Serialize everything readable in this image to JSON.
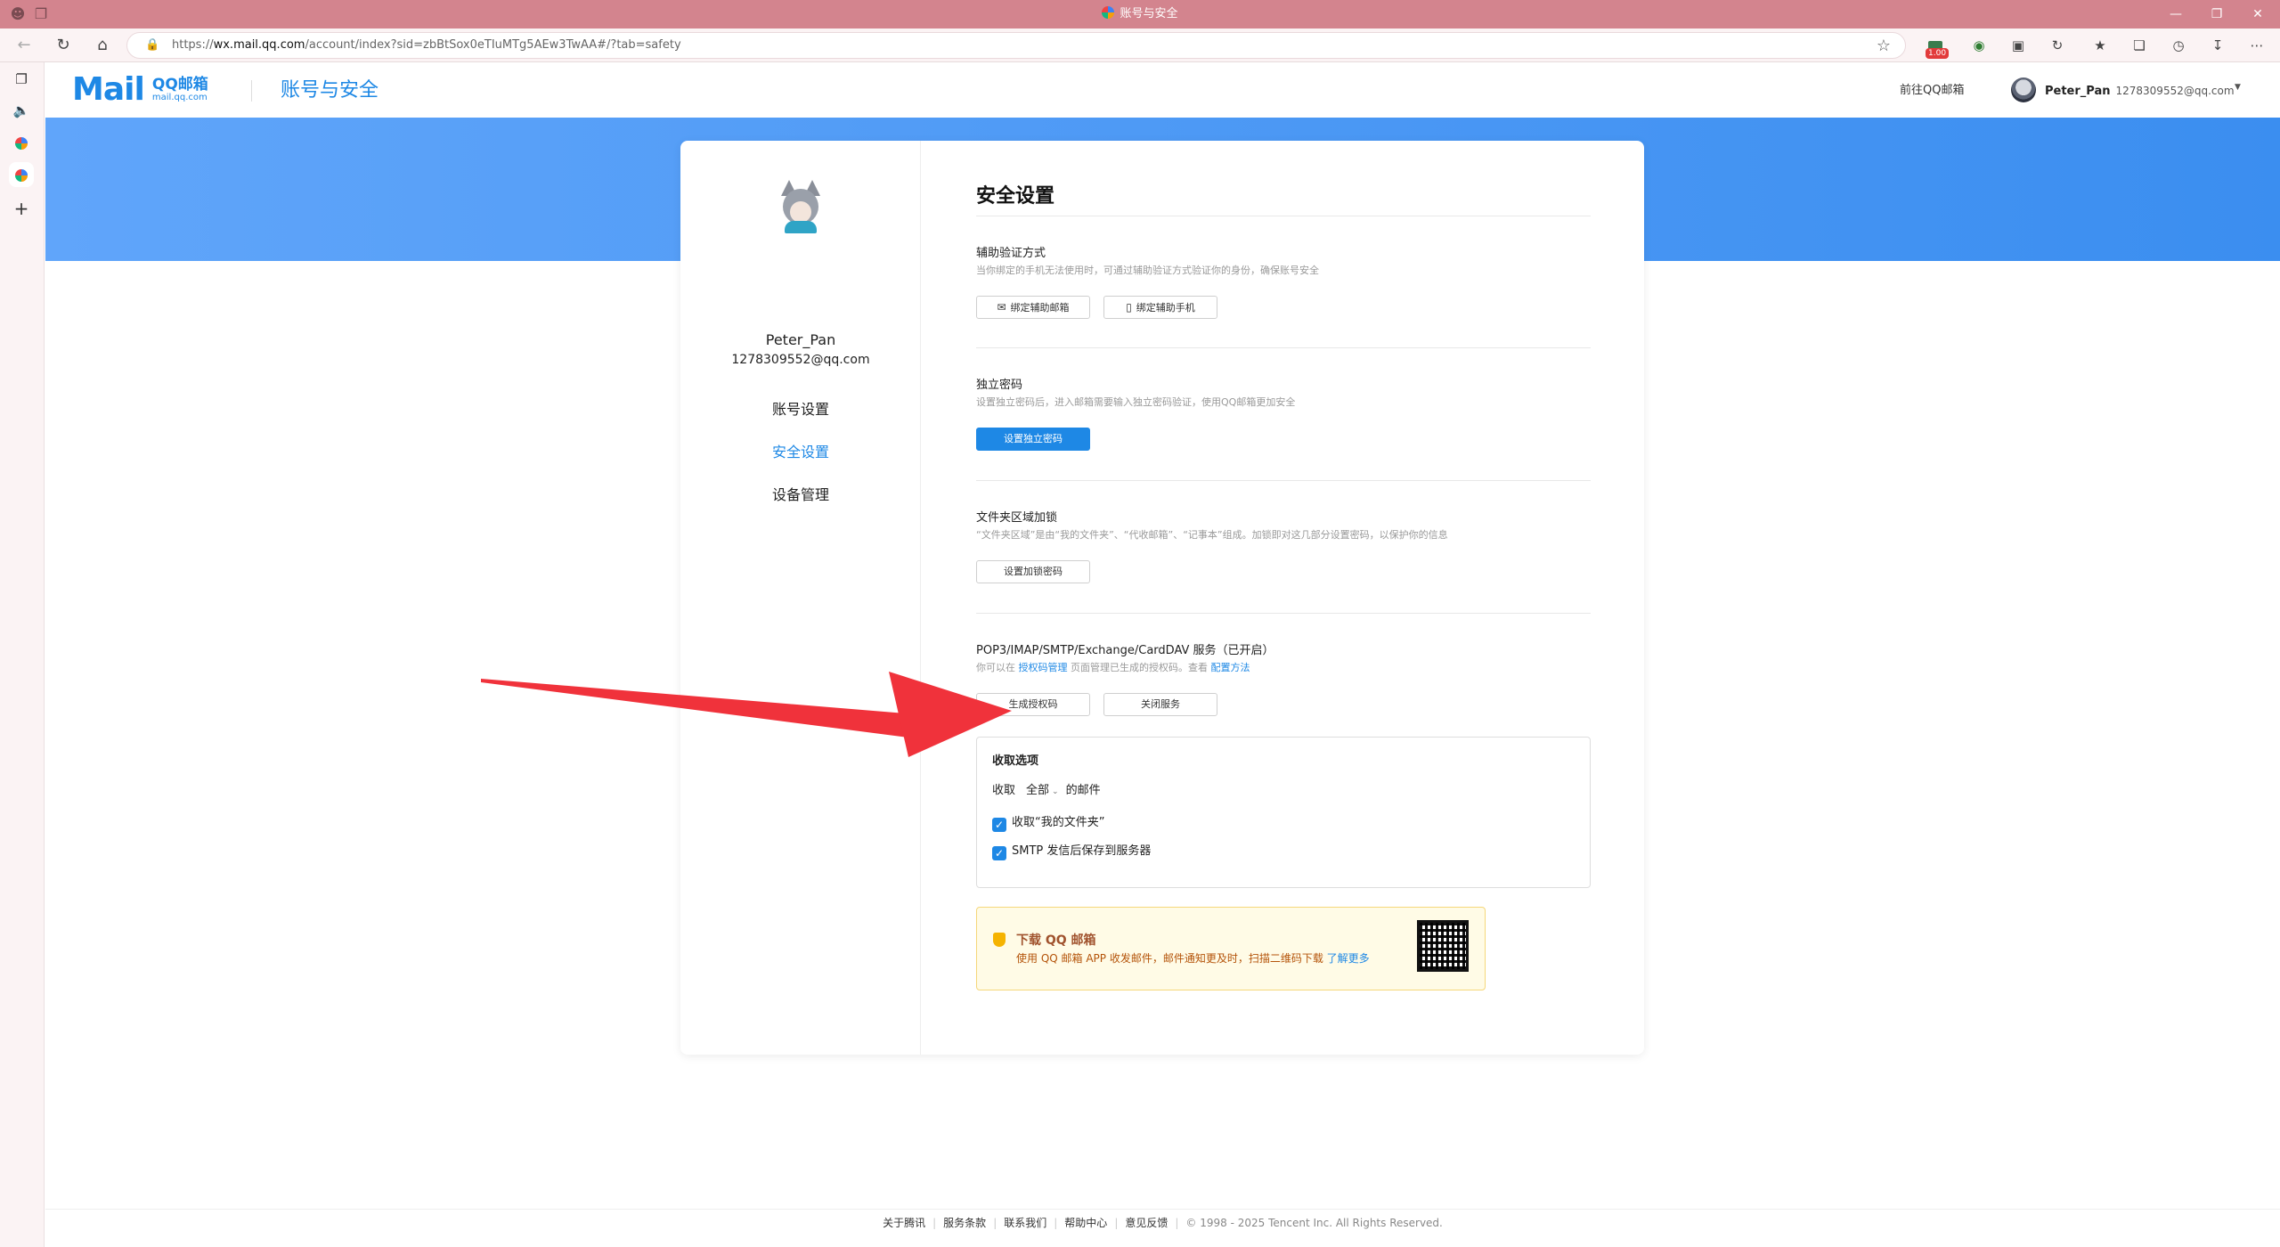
{
  "browser": {
    "tab_title": "账号与安全",
    "url_prefix": "https://",
    "url_host": "wx.mail.qq.com",
    "url_path": "/account/index?sid=zbBtSox0eTIuMTg5AEw3TwAA#/?tab=safety",
    "extension_badge": "1.00"
  },
  "header": {
    "logo_word": "Mail",
    "logo_line1": "QQ邮箱",
    "logo_line2": "mail.qq.com",
    "page_title": "账号与安全",
    "goto_mail": "前往QQ邮箱",
    "user_name": "Peter_Pan",
    "user_email": "1278309552@qq.com"
  },
  "sidebar": {
    "name": "Peter_Pan",
    "email": "1278309552@qq.com",
    "items": [
      {
        "label": "账号设置",
        "active": false
      },
      {
        "label": "安全设置",
        "active": true
      },
      {
        "label": "设备管理",
        "active": false
      }
    ]
  },
  "main": {
    "title": "安全设置",
    "aux_verify": {
      "title": "辅助验证方式",
      "desc": "当你绑定的手机无法使用时，可通过辅助验证方式验证你的身份，确保账号安全",
      "bind_email": "绑定辅助邮箱",
      "bind_phone": "绑定辅助手机"
    },
    "independent_pwd": {
      "title": "独立密码",
      "desc": "设置独立密码后，进入邮箱需要输入独立密码验证，使用QQ邮箱更加安全",
      "button": "设置独立密码"
    },
    "folder_lock": {
      "title": "文件夹区域加锁",
      "desc": "“文件夹区域”是由“我的文件夹”、“代收邮箱”、“记事本”组成。加锁即对这几部分设置密码，以保护你的信息",
      "button": "设置加锁密码"
    },
    "pop3": {
      "title": "POP3/IMAP/SMTP/Exchange/CardDAV 服务（已开启）",
      "desc_pre": "你可以在",
      "desc_link1": "授权码管理",
      "desc_mid": "页面管理已生成的授权码。查看",
      "desc_link2": "配置方法",
      "gen_code": "生成授权码",
      "close_service": "关闭服务"
    },
    "receive": {
      "title": "收取选项",
      "row_pre": "收取",
      "select_value": "全部",
      "row_post": "的邮件",
      "check1": "收取“我的文件夹”",
      "check2": "SMTP 发信后保存到服务器"
    },
    "download": {
      "title": "下载 QQ 邮箱",
      "desc": "使用 QQ 邮箱 APP 收发邮件，邮件通知更及时，扫描二维码下载",
      "link": "了解更多"
    }
  },
  "footer": {
    "links": [
      "关于腾讯",
      "服务条款",
      "联系我们",
      "帮助中心",
      "意见反馈"
    ],
    "copyright": "© 1998 - 2025 Tencent Inc. All Rights Reserved."
  },
  "colors": {
    "accent": "#1e88e5",
    "banner": "#4a9bf5",
    "arrow": "#f0323b",
    "titlebar": "#d3848e"
  }
}
